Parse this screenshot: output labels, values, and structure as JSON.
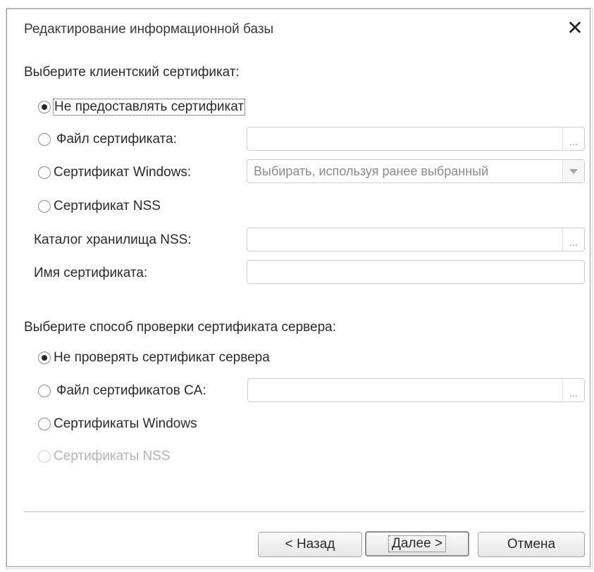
{
  "dialog": {
    "title": "Редактирование информационной базы",
    "close_glyph": "✕"
  },
  "client_cert": {
    "heading": "Выберите клиентский сертификат:",
    "options": [
      {
        "label": "Не предоставлять сертификат",
        "selected": true
      },
      {
        "label": "Файл сертификата:",
        "selected": false
      },
      {
        "label": "Сертификат Windows:",
        "selected": false
      },
      {
        "label": "Сертификат NSS",
        "selected": false
      }
    ],
    "file_field": {
      "value": "",
      "button": "..."
    },
    "windows_select": {
      "value": "Выбирать, используя ранее выбранный"
    },
    "nss_store_label": "Каталог хранилища NSS:",
    "nss_store_field": {
      "value": "",
      "button": "..."
    },
    "cert_name_label": "Имя сертификата:",
    "cert_name_field": {
      "value": ""
    }
  },
  "server_cert": {
    "heading": "Выберите способ проверки сертификата сервера:",
    "options": [
      {
        "label": "Не проверять сертификат сервера",
        "selected": true
      },
      {
        "label": "Файл сертификатов CA:",
        "selected": false
      },
      {
        "label": "Сертификаты Windows",
        "selected": false
      },
      {
        "label": "Сертификаты NSS",
        "selected": false,
        "disabled": true
      }
    ],
    "ca_field": {
      "value": "",
      "button": "..."
    }
  },
  "buttons": {
    "back": "< Назад",
    "next": "Далее >",
    "cancel": "Отмена"
  }
}
